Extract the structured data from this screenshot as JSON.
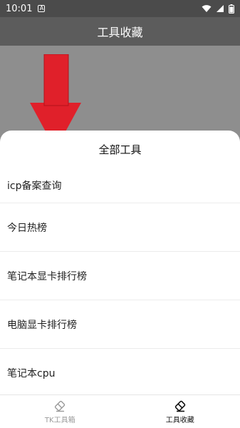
{
  "status_bar": {
    "time": "10:01",
    "notification_icon": "a-box-icon",
    "icons": [
      "wifi-icon",
      "cellular-icon",
      "battery-icon"
    ]
  },
  "app_bar": {
    "title": "工具收藏"
  },
  "sheet": {
    "title": "全部工具",
    "items": [
      {
        "label": "icp备案查询"
      },
      {
        "label": "今日热榜"
      },
      {
        "label": "笔记本显卡排行榜"
      },
      {
        "label": "电脑显卡排行榜"
      },
      {
        "label": "笔记本cpu"
      }
    ]
  },
  "bottom_nav": {
    "tabs": [
      {
        "label": "TK工具箱",
        "icon": "eraser-icon",
        "active": false
      },
      {
        "label": "工具收藏",
        "icon": "eraser-icon",
        "active": true
      }
    ]
  },
  "colors": {
    "status_bar": "#4b4b4b",
    "app_bar": "#5c5c5c",
    "overlay": "#8e8e8e",
    "arrow": "#e0202a",
    "active_tab": "#111111",
    "inactive_tab": "#9a9a9a"
  }
}
